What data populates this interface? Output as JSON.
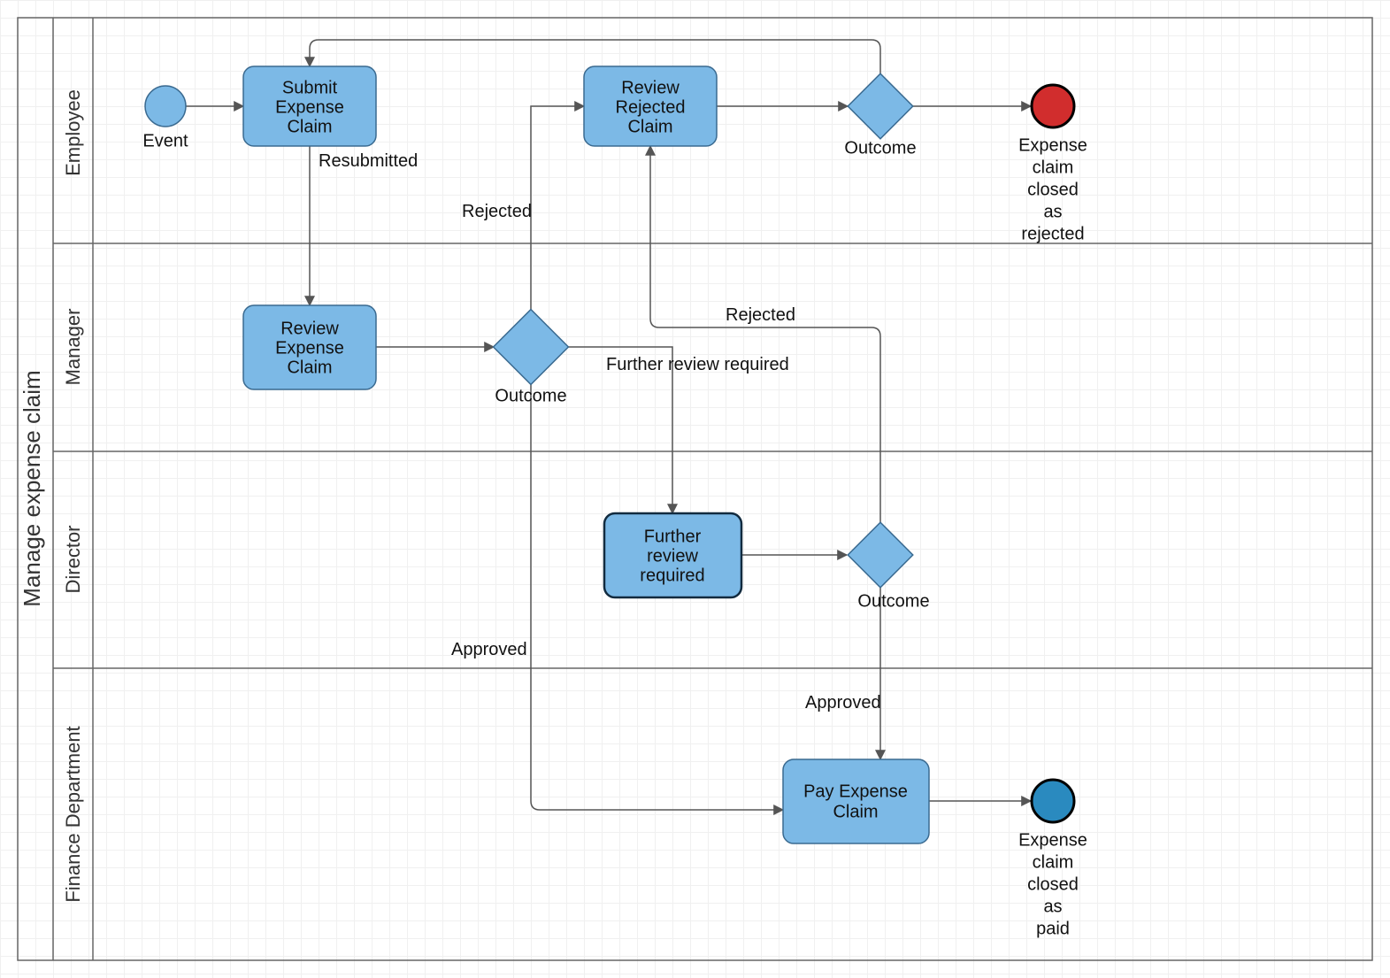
{
  "pool": {
    "title": "Manage expense claim"
  },
  "lanes": {
    "employee": "Employee",
    "manager": "Manager",
    "director": "Director",
    "finance": "Finance Department"
  },
  "nodes": {
    "start": {
      "label": "Event"
    },
    "submit": {
      "l1": "Submit",
      "l2": "Expense",
      "l3": "Claim"
    },
    "reviewRej": {
      "l1": "Review",
      "l2": "Rejected",
      "l3": "Claim"
    },
    "gwEmp": {
      "label": "Outcome"
    },
    "endRej": {
      "l1": "Expense",
      "l2": "claim",
      "l3": "closed",
      "l4": "as",
      "l5": "rejected"
    },
    "reviewExp": {
      "l1": "Review",
      "l2": "Expense",
      "l3": "Claim"
    },
    "gwMgr": {
      "label": "Outcome"
    },
    "further": {
      "l1": "Further",
      "l2": "review",
      "l3": "required"
    },
    "gwDir": {
      "label": "Outcome"
    },
    "pay": {
      "l1": "Pay Expense",
      "l2": "Claim"
    },
    "endPaid": {
      "l1": "Expense",
      "l2": "claim",
      "l3": "closed",
      "l4": "as",
      "l5": "paid"
    }
  },
  "edges": {
    "resubmitted": "Resubmitted",
    "rejectedMgr": "Rejected",
    "furtherReq": "Further review required",
    "approvedMgr": "Approved",
    "rejectedDir": "Rejected",
    "approvedDir": "Approved"
  }
}
